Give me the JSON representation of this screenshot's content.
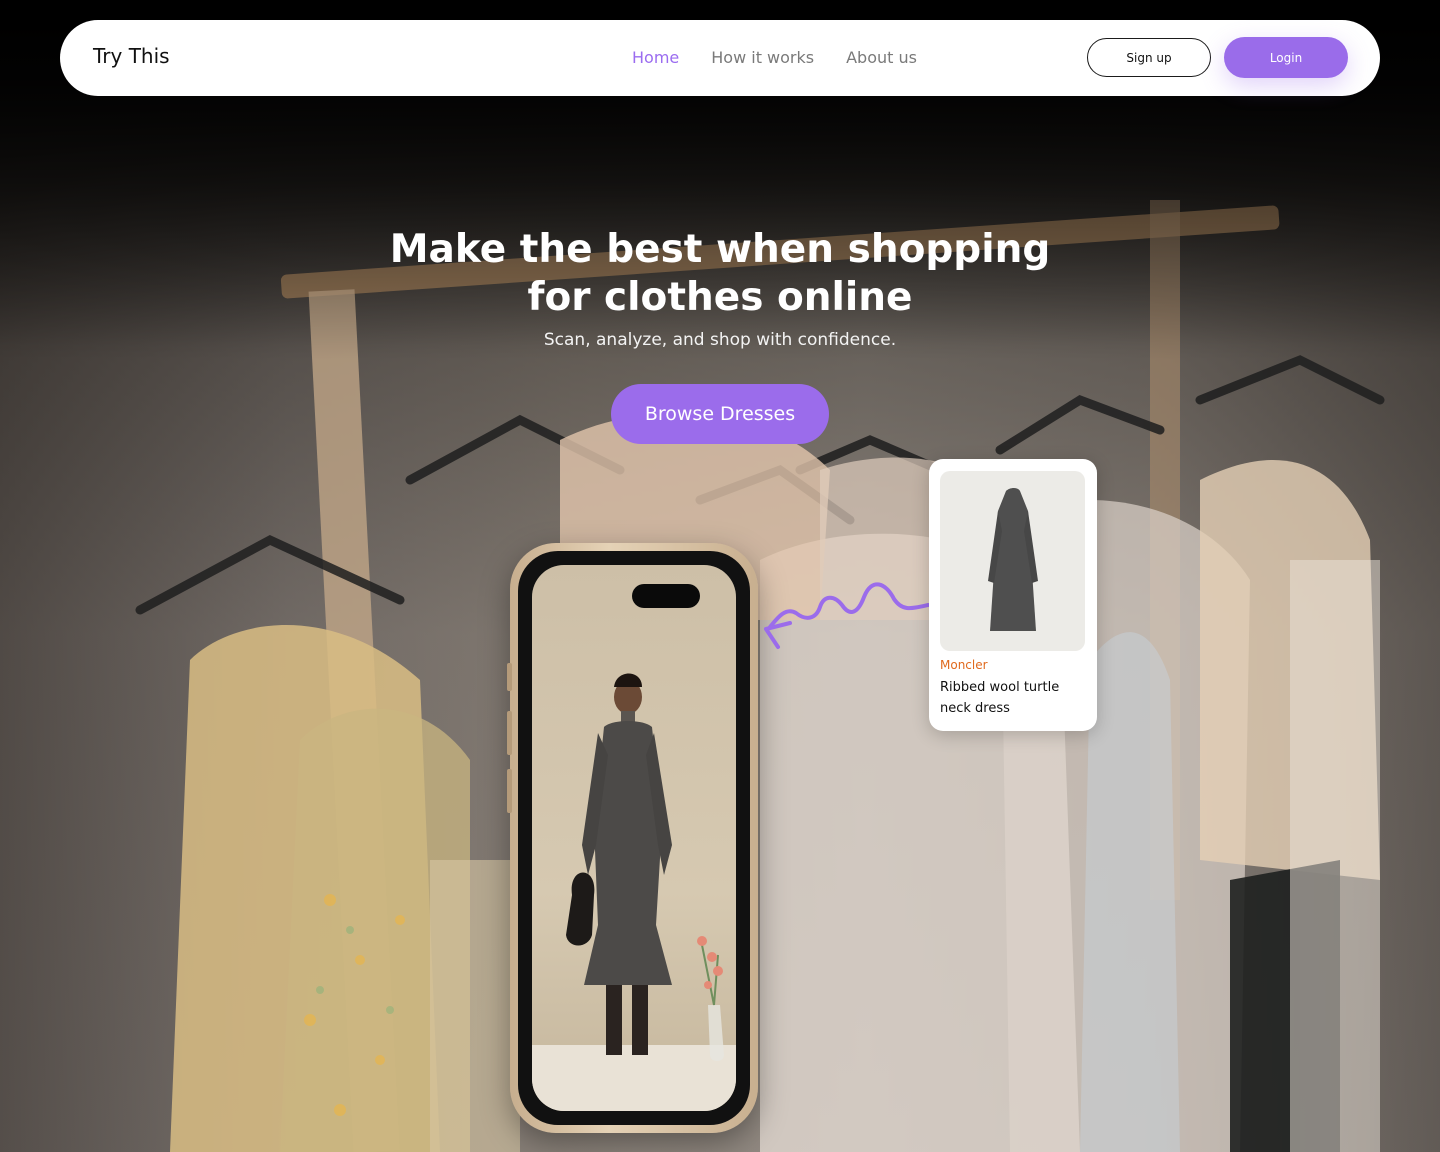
{
  "nav": {
    "brand": "Try This",
    "links": [
      "Home",
      "How it works",
      "About us"
    ],
    "active_link": "Home",
    "signup_label": "Sign up",
    "login_label": "Login"
  },
  "hero": {
    "title_line1": "Make the best when shopping",
    "title_line2": "for clothes online",
    "subtitle": "Scan, analyze, and shop with confidence.",
    "cta_label": "Browse Dresses"
  },
  "product_card": {
    "brand": "Moncler",
    "name": "Ribbed wool turtle neck dress"
  },
  "colors": {
    "accent": "#9b6ceb",
    "brand_label": "#e06a1e"
  }
}
